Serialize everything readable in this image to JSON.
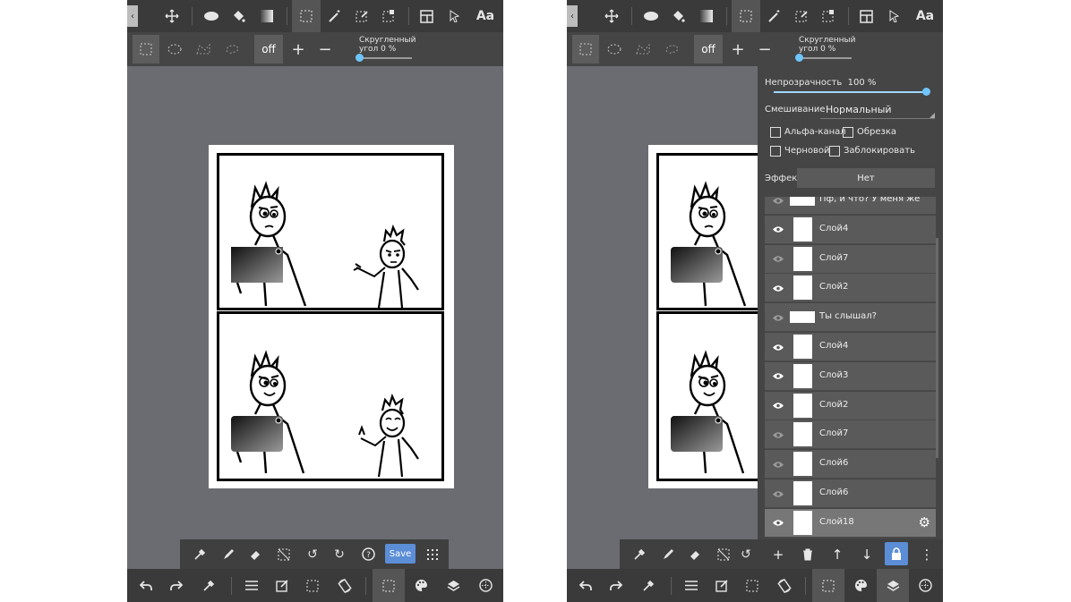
{
  "left": {
    "bottom_quick_save": "Save"
  },
  "toolbar_top": {
    "text_tool": "Aa"
  },
  "toolbar_sub": {
    "off_label": "off",
    "plus": "+",
    "minus": "−",
    "rounded_corner_label": "Скругленный",
    "rounded_corner_value": "угол 0 %",
    "rounded_corner_value_num": 0
  },
  "layer_panel": {
    "opacity_label": "Непрозрачность",
    "opacity_value": "100 %",
    "opacity_fraction": 1.0,
    "blend_label": "Смешивание",
    "blend_value": "Нормальный",
    "checkboxes": [
      {
        "label": "Альфа-канал",
        "checked": false
      },
      {
        "label": "Обрезка",
        "checked": false
      },
      {
        "label": "Черновой",
        "checked": false
      },
      {
        "label": "Заблокировать",
        "checked": false
      }
    ],
    "effect_label": "Эффект",
    "effect_value": "Нет",
    "layers": [
      {
        "name": "Пф, и что? У меня же",
        "visible": false,
        "kind": "text"
      },
      {
        "name": "Слой4",
        "visible": true,
        "kind": "image"
      },
      {
        "name": "Слой7",
        "visible": false,
        "kind": "image"
      },
      {
        "name": "Слой2",
        "visible": true,
        "kind": "image"
      },
      {
        "name": "Ты слышал?",
        "visible": false,
        "kind": "text"
      },
      {
        "name": "Слой4",
        "visible": true,
        "kind": "image"
      },
      {
        "name": "Слой3",
        "visible": true,
        "kind": "image"
      },
      {
        "name": "Слой2",
        "visible": true,
        "kind": "image"
      },
      {
        "name": "Слой7",
        "visible": false,
        "kind": "image"
      },
      {
        "name": "Слой6",
        "visible": false,
        "kind": "image"
      },
      {
        "name": "Слой6",
        "visible": false,
        "kind": "image"
      },
      {
        "name": "Слой18",
        "visible": true,
        "kind": "image",
        "selected": true
      }
    ]
  },
  "colors": {
    "accent": "#5b8ed6",
    "slider": "#6fc6ff",
    "canvas_bg": "#6b6c72",
    "toolbar_bg": "#3a3a3a"
  }
}
